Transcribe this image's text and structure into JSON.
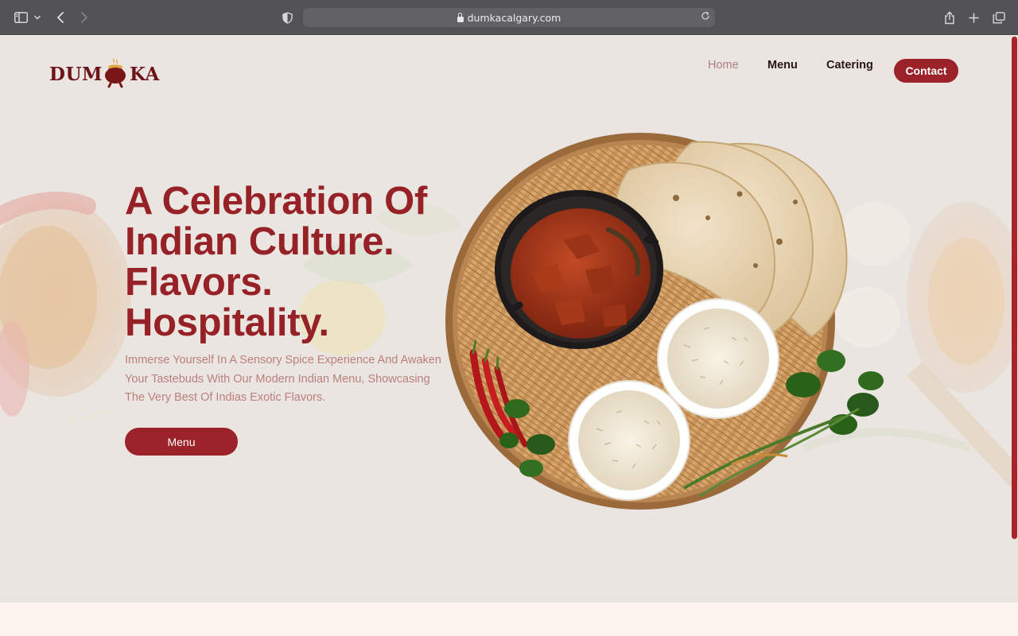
{
  "browser": {
    "url": "dumkacalgary.com",
    "icons": [
      "sidebar-icon",
      "chevron-down-icon",
      "back-icon",
      "forward-icon",
      "shield-icon",
      "lock-icon",
      "reload-icon",
      "share-icon",
      "new-tab-icon",
      "tabs-overview-icon"
    ]
  },
  "header": {
    "logo": {
      "left": "DUM",
      "right": "KA",
      "icon": "clay-pot-icon"
    },
    "nav": {
      "home": "Home",
      "menu": "Menu",
      "catering": "Catering",
      "contact": "Contact"
    }
  },
  "hero": {
    "headline": [
      "A Celebration Of",
      "Indian Culture.",
      "Flavors.",
      "Hospitality."
    ],
    "subtext": "Immerse Yourself In A Sensory Spice Experience And Awaken Your Tastebuds With Our Modern Indian Menu, Showcasing The Very Best Of Indias Exotic Flavors.",
    "cta_label": "Menu",
    "image": "food-platter-image"
  },
  "colors": {
    "brand": "#9b2228",
    "brand_dark": "#6d1418",
    "hero_bg": "#ebe5e1",
    "nav_active": "#b27c7f",
    "subtext": "#bb7f7e",
    "chrome": "#535256"
  }
}
